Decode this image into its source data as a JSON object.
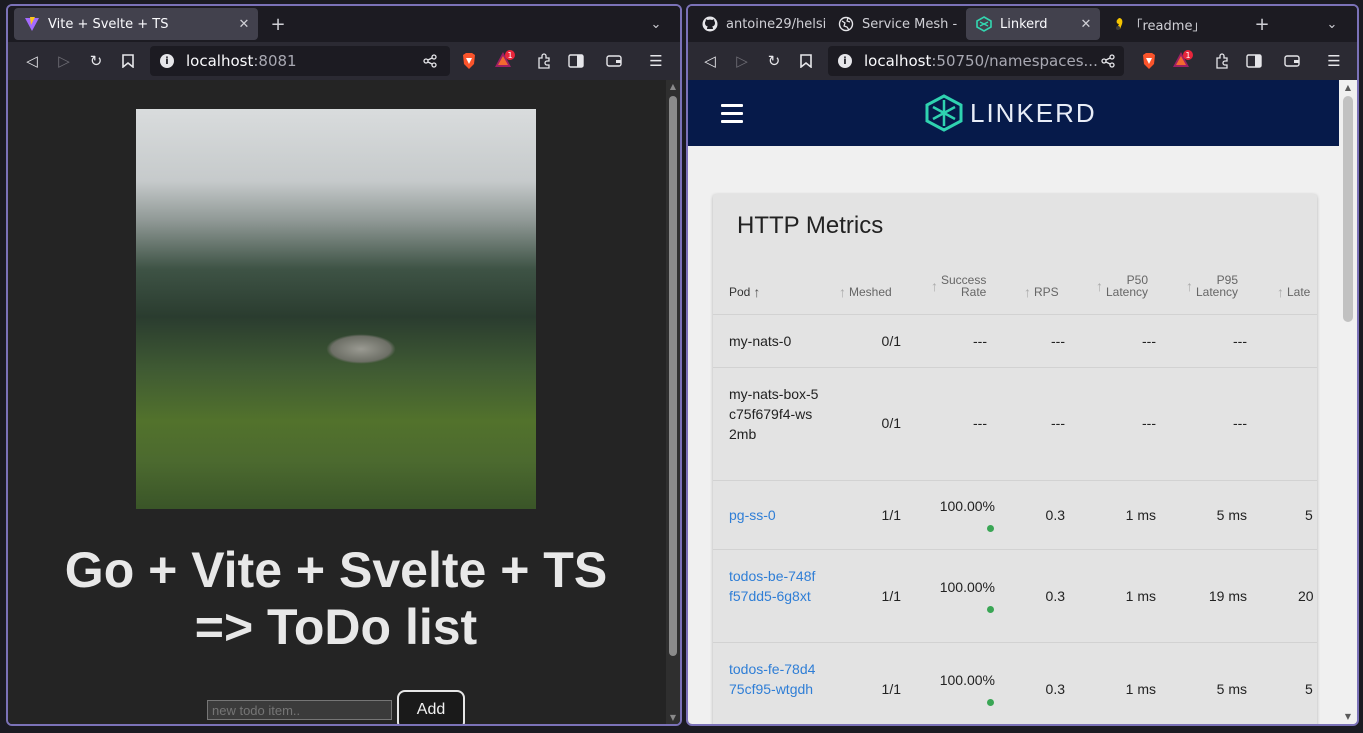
{
  "left_window": {
    "tabs": [
      {
        "title": "Vite + Svelte + TS",
        "active": true
      }
    ],
    "url_host": "localhost",
    "url_rest": ":8081",
    "shields_count": "1",
    "app": {
      "heading_line1": "Go + Vite + Svelte + TS",
      "heading_line2": "=> ToDo list",
      "input_placeholder": "new todo item..",
      "add_label": "Add"
    }
  },
  "right_window": {
    "tabs": [
      {
        "title": "antoine29/helsi",
        "active": false,
        "icon": "github-icon"
      },
      {
        "title": "Service Mesh -",
        "active": false,
        "icon": "globe-icon"
      },
      {
        "title": "Linkerd",
        "active": true,
        "icon": "linkerd-icon"
      },
      {
        "title": "｢readme｣",
        "active": false,
        "icon": "readme-icon"
      }
    ],
    "url_host": "localhost",
    "url_rest": ":50750/namespaces...",
    "shields_count": "1",
    "app": {
      "brand": "LINKERD",
      "card_title": "HTTP Metrics",
      "columns": {
        "pod": "Pod",
        "meshed": "Meshed",
        "success_1": "Success",
        "success_2": "Rate",
        "rps": "RPS",
        "p50_1": "P50",
        "p50_2": "Latency",
        "p95_1": "P95",
        "p95_2": "Latency",
        "p99_2": "Late"
      },
      "rows": [
        {
          "pod": "my-nats-0",
          "meshed": "0/1",
          "success": "---",
          "rps": "---",
          "p50": "---",
          "p95": "---",
          "p99": ""
        },
        {
          "pod": "my-nats-box-5c75f679f4-ws2mb",
          "meshed": "0/1",
          "success": "---",
          "rps": "---",
          "p50": "---",
          "p95": "---",
          "p99": ""
        },
        {
          "pod": "pg-ss-0",
          "meshed": "1/1",
          "success": "100.00%",
          "rps": "0.3",
          "p50": "1 ms",
          "p95": "5 ms",
          "p99": "5"
        },
        {
          "pod": "todos-be-748ff57dd5-6g8xt",
          "meshed": "1/1",
          "success": "100.00%",
          "rps": "0.3",
          "p50": "1 ms",
          "p95": "19 ms",
          "p99": "20"
        },
        {
          "pod": "todos-fe-78d475cf95-wtgdh",
          "meshed": "1/1",
          "success": "100.00%",
          "rps": "0.3",
          "p50": "1 ms",
          "p95": "5 ms",
          "p99": "5"
        }
      ]
    }
  },
  "colors": {
    "accent_link": "#2f7ed6",
    "linkerd_header": "#061a4a",
    "success_dot": "#3aa655"
  }
}
